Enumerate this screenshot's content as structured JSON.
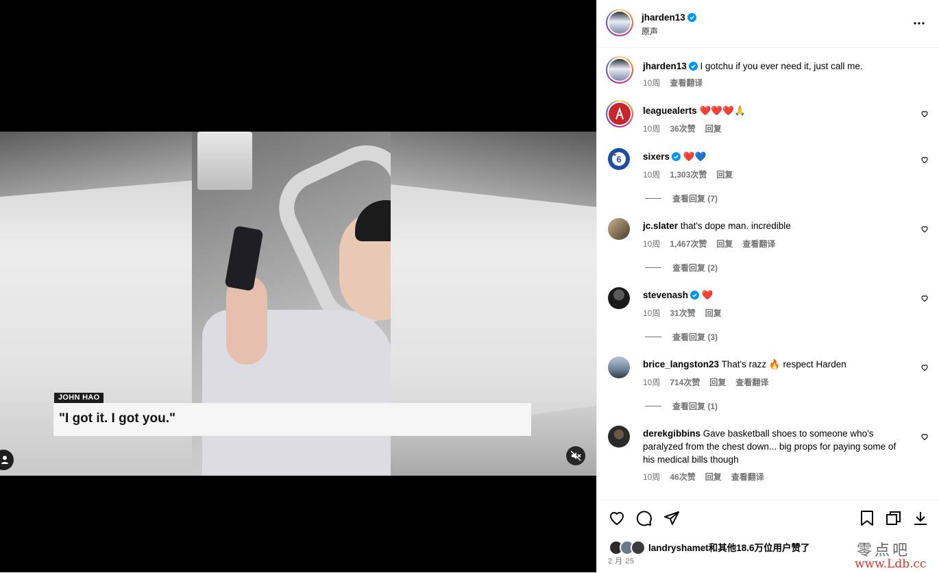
{
  "video": {
    "nameplate": "JOHN HAO",
    "caption": "\"I got it. I got you.\""
  },
  "header": {
    "username": "jharden13",
    "audio": "原声"
  },
  "post": {
    "username": "jharden13",
    "caption": "I gotchu if you ever need it, just call me.",
    "age": "10周",
    "translate": "查看翻译"
  },
  "comments": [
    {
      "username": "leaguealerts",
      "text": "❤️❤️❤️🙏",
      "age": "10周",
      "likes": "36次赞",
      "reply": "回复",
      "translate": ""
    },
    {
      "username": "sixers",
      "text": "❤️💙",
      "age": "10周",
      "likes": "1,303次赞",
      "reply": "回复",
      "translate": "",
      "view_replies": "查看回复 (7)"
    },
    {
      "username": "jc.slater",
      "text": "that's dope man. incredible",
      "age": "10周",
      "likes": "1,467次赞",
      "reply": "回复",
      "translate": "查看翻译",
      "view_replies": "查看回复 (2)"
    },
    {
      "username": "stevenash",
      "text": "❤️",
      "age": "10周",
      "likes": "31次赞",
      "reply": "回复",
      "translate": "",
      "view_replies": "查看回复 (3)"
    },
    {
      "username": "brice_langston23",
      "text": "That's razz 🔥 respect Harden",
      "age": "10周",
      "likes": "714次赞",
      "reply": "回复",
      "translate": "查看翻译",
      "view_replies": "查看回复 (1)"
    },
    {
      "username": "derekgibbins",
      "text_lines": [
        "Gave basketball shoes to someone who's",
        "paralyzed from the chest down... big props for paying some of",
        "his medical bills though"
      ],
      "age": "10周",
      "likes": "46次赞",
      "reply": "回复",
      "translate": "查看翻译"
    }
  ],
  "footer": {
    "liked_by": "landryshamet和其他18.6万位用户赞了",
    "date": "2 月 25"
  },
  "watermark": {
    "cn": "零点吧",
    "url": "www.Ldb.cc"
  },
  "colors": {
    "verified": "#0095f6",
    "heart_red": "#e02632",
    "heart_blue": "#1e88e5",
    "meta_gray": "#737373"
  },
  "icons": [
    "verified-badge-icon",
    "more-options-icon",
    "heart-icon",
    "comment-icon",
    "share-icon",
    "bookmark-icon",
    "multi-view-icon",
    "download-icon",
    "mute-icon",
    "user-tag-icon"
  ]
}
